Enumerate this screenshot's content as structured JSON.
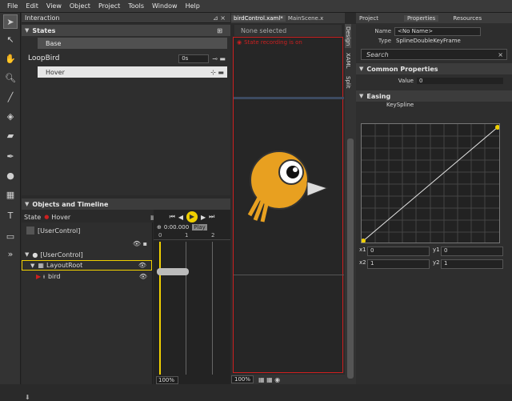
{
  "menu": [
    "File",
    "Edit",
    "View",
    "Object",
    "Project",
    "Tools",
    "Window",
    "Help"
  ],
  "tools": [
    "arrow-select-icon",
    "direct-select-icon",
    "pan-hand-icon",
    "zoom-icon",
    "eyedropper-icon",
    "paint-bucket-icon",
    "brush-icon",
    "pen-icon",
    "ellipse-icon",
    "grid-layout-icon",
    "text-tool-icon",
    "controls-icon",
    "chevron-right-icon"
  ],
  "interaction": {
    "title": "Interaction",
    "states_header": "States",
    "base_label": "Base",
    "group_name": "LoopBird",
    "transition_value": "0s",
    "hover_state": "Hover"
  },
  "objects": {
    "title": "Objects and Timeline",
    "state_label": "State",
    "state_value": "Hover",
    "root_item": "[UserControl]",
    "tree": [
      "[UserControl]",
      "LayoutRoot",
      "bird"
    ],
    "time_value": "0:00.000",
    "ruler": [
      "0",
      "1",
      "2"
    ],
    "zoom": "100%",
    "play_tooltip": "Play"
  },
  "doc": {
    "tabs": [
      "birdControl.xaml*",
      "MainScene.x"
    ],
    "selection": "None selected",
    "recording_text": "State recording is on",
    "side_tabs": [
      "Design",
      "XAML",
      "Split"
    ],
    "zoom": "100%"
  },
  "right": {
    "tabs": [
      "Project",
      "Properties",
      "Resources"
    ],
    "name_label": "Name",
    "name_value": "<No Name>",
    "type_label": "Type",
    "type_value": "SplineDoubleKeyFrame",
    "search_placeholder": "Search",
    "common_header": "Common Properties",
    "value_label": "Value",
    "value_value": "0",
    "easing_header": "Easing",
    "keyspline_label": "KeySpline",
    "x1_label": "x1",
    "x1_value": "0",
    "y1_label": "y1",
    "y1_value": "0",
    "x2_label": "x2",
    "x2_value": "1",
    "y2_label": "y2",
    "y2_value": "1"
  },
  "colors": {
    "accent": "#f0d000",
    "recording": "#cc2020",
    "bird": "#e8a020"
  }
}
